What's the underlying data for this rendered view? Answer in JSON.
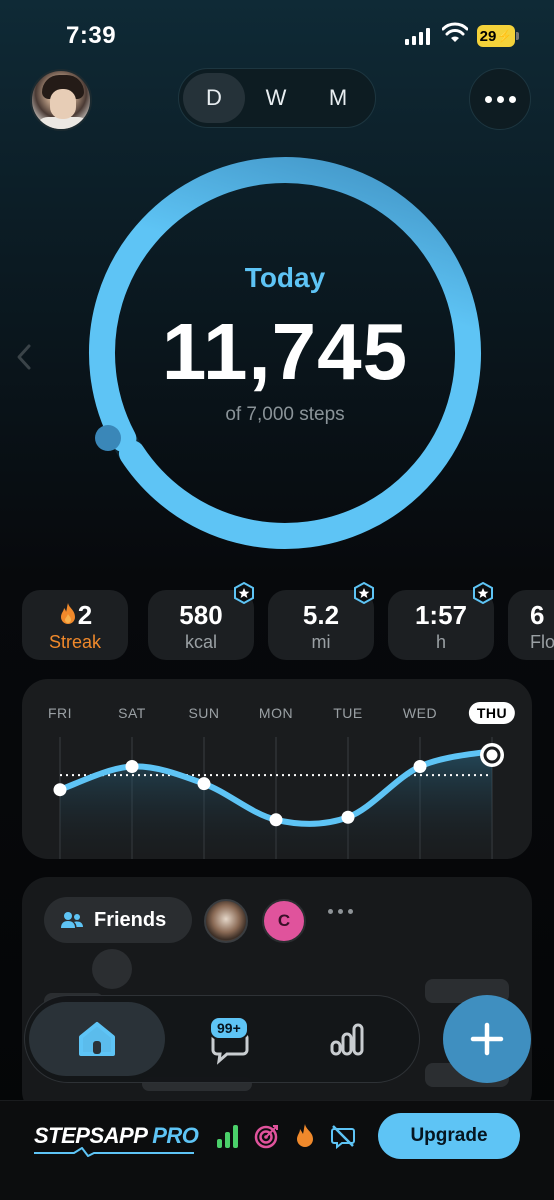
{
  "status_bar": {
    "time": "7:39",
    "battery": "29"
  },
  "segmented": {
    "options": [
      "D",
      "W",
      "M"
    ],
    "selected": "D"
  },
  "ring": {
    "label": "Today",
    "value": "11,745",
    "subtitle": "of 7,000 steps",
    "progress_fraction": 1.0,
    "color": "#5ec4f5"
  },
  "stats": [
    {
      "value": "2",
      "label": "Streak",
      "icon": "flame-icon",
      "badge": false
    },
    {
      "value": "580",
      "label": "kcal",
      "badge": true
    },
    {
      "value": "5.2",
      "label": "mi",
      "badge": true
    },
    {
      "value": "1:57",
      "label": "h",
      "badge": true
    },
    {
      "value": "6",
      "label": "Flo",
      "badge": true
    }
  ],
  "week": {
    "days": [
      "FRI",
      "SAT",
      "SUN",
      "MON",
      "TUE",
      "WED",
      "THU"
    ],
    "today": "THU",
    "relative_values": [
      0.55,
      0.82,
      0.62,
      0.2,
      0.23,
      0.82,
      1.0
    ],
    "goal_relative": 0.72
  },
  "friends": {
    "label": "Friends",
    "friend_initial": "C"
  },
  "tabbar": {
    "chat_badge": "99+"
  },
  "promo": {
    "brand_main": "STEPSAPP",
    "brand_pro": "PRO",
    "upgrade_label": "Upgrade"
  },
  "colors": {
    "accent": "#5ec4f5",
    "streak": "#f0892b",
    "fab": "#3f8fc0"
  }
}
